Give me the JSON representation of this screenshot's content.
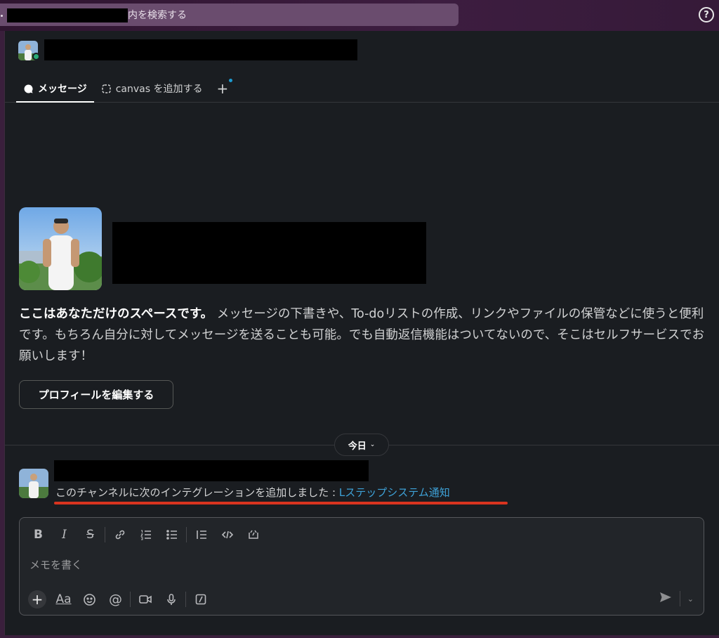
{
  "search": {
    "suffix_text": "内を検索する"
  },
  "help": {
    "glyph": "?"
  },
  "tabs": [
    {
      "label": "メッセージ",
      "icon": "message-bubble-icon"
    },
    {
      "label": "canvas を追加する",
      "icon": "canvas-icon"
    }
  ],
  "add_tab": {
    "glyph": "+"
  },
  "intro": {
    "bold": "ここはあなただけのスペースです。",
    "body": " メッセージの下書きや、To-doリストの作成、リンクやファイルの保管などに使うと便利です。もちろん自分に対してメッセージを送ることも可能。でも自動返信機能はついてないので、そこはセルフサービスでお願いします！"
  },
  "edit_profile_label": "プロフィールを編集する",
  "date_divider": {
    "label": "今日"
  },
  "message": {
    "text": "このチャンネルに次のインテグレーションを追加しました : ",
    "link": "Lステップシステム通知"
  },
  "composer": {
    "placeholder": "メモを書く",
    "format_buttons": [
      "B",
      "I",
      "S"
    ],
    "text_format_label": "Aa"
  },
  "colors": {
    "panel_bg": "#1a1d21",
    "topbar": "#3a1f3c",
    "link": "#3ea2d8",
    "presence": "#2bac76",
    "annotation_red": "#d8341f"
  }
}
